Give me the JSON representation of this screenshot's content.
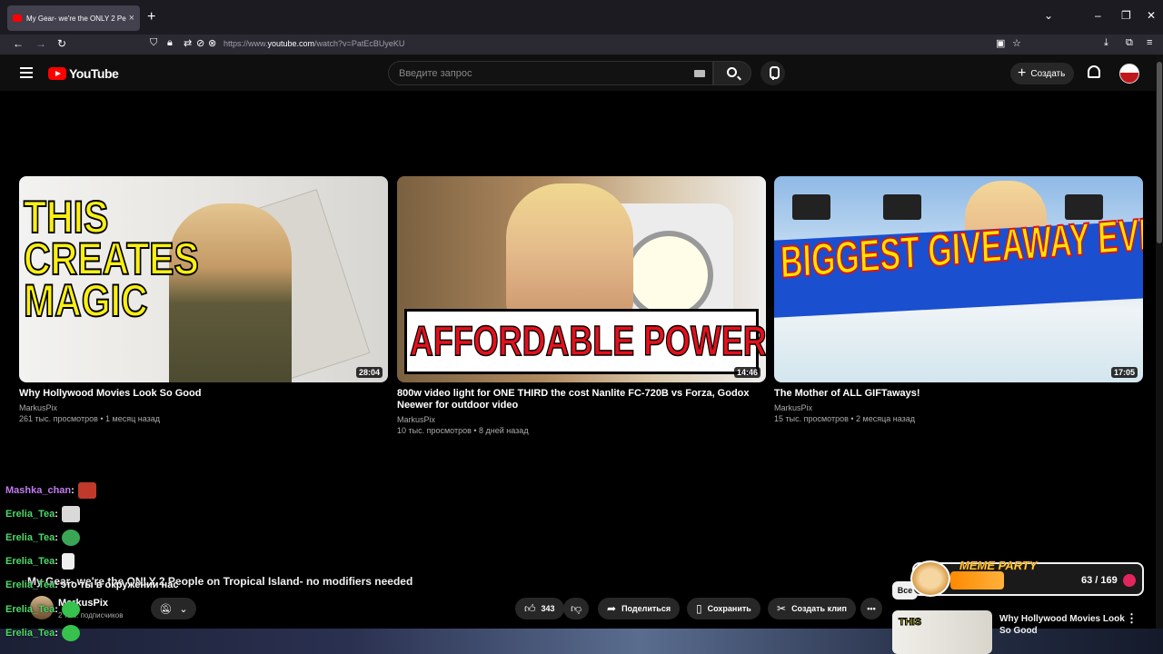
{
  "browser": {
    "tab_title": "My Gear- we're the ONLY 2 People on Tropical Island- no modifiers needed",
    "url_prefix": "https://www.",
    "url_domain": "youtube.com",
    "url_path": "/watch?v=PatEcBUyeKU",
    "new_tab": "+",
    "tab_close": "×"
  },
  "youtube": {
    "logo_text": "YouTube",
    "search_placeholder": "Введите запрос",
    "create_label": "Создать"
  },
  "end_screen": {
    "videos": [
      {
        "title": "Why Hollywood Movies Look So Good",
        "channel": "MarkusPix",
        "meta": "261 тыс. просмотров • 1 месяц назад",
        "duration": "28:04",
        "thumb_text": "THIS CREATES MAGIC"
      },
      {
        "title": "800w video light for ONE THIRD the cost Nanlite FC-720B vs Forza, Godox Neewer for outdoor video",
        "channel": "MarkusPix",
        "meta": "10 тыс. просмотров • 8 дней назад",
        "duration": "14:46",
        "thumb_text": "AFFORDABLE POWER!"
      },
      {
        "title": "The Mother of ALL GIFTaways!",
        "channel": "MarkusPix",
        "meta": "15 тыс. просмотров • 2 месяца назад",
        "duration": "17:05",
        "thumb_text": "BIGGEST GIVEAWAY EVER!"
      }
    ]
  },
  "chat": [
    {
      "user": "Mashka_chan",
      "message": "",
      "emote_color": "#c0392b"
    },
    {
      "user": "Erelia_Tea",
      "message": "",
      "emote_color": "#d9d9d9"
    },
    {
      "user": "Erelia_Tea",
      "message": "",
      "emote_color": "#3aa655"
    },
    {
      "user": "Erelia_Tea",
      "message": "",
      "emote_color": "#eeeeee"
    },
    {
      "user": "Erelia_Tea",
      "message": "это ты в окружении нас",
      "emote_color": ""
    },
    {
      "user": "Erelia_Tea",
      "message": "",
      "emote_color": "#36c24d"
    },
    {
      "user": "Erelia_Tea",
      "message": "",
      "emote_color": "#36c24d"
    }
  ],
  "player": {
    "video_title": "My Gear- we're the ONLY 2 People on Tropical Island- no modifiers needed",
    "channel_name": "MarkusPix",
    "subscribers": "2 тыс. подписчиков",
    "likes": "343",
    "share_label": "Поделиться",
    "save_label": "Сохранить",
    "clip_label": "Создать клип",
    "more": "•••"
  },
  "meme_party": {
    "label": "MEME PARTY",
    "count": "63 / 169",
    "progress": 0.37
  },
  "sidebar": {
    "chip_all": "Все",
    "rec_title": "Why Hollywood Movies Look So Good",
    "rec_thumb_text": "THIS"
  },
  "colors": {
    "yt_red": "#ff0000",
    "chat_name_purple": "#c07bf0",
    "chat_name_green": "#4fd86a"
  }
}
